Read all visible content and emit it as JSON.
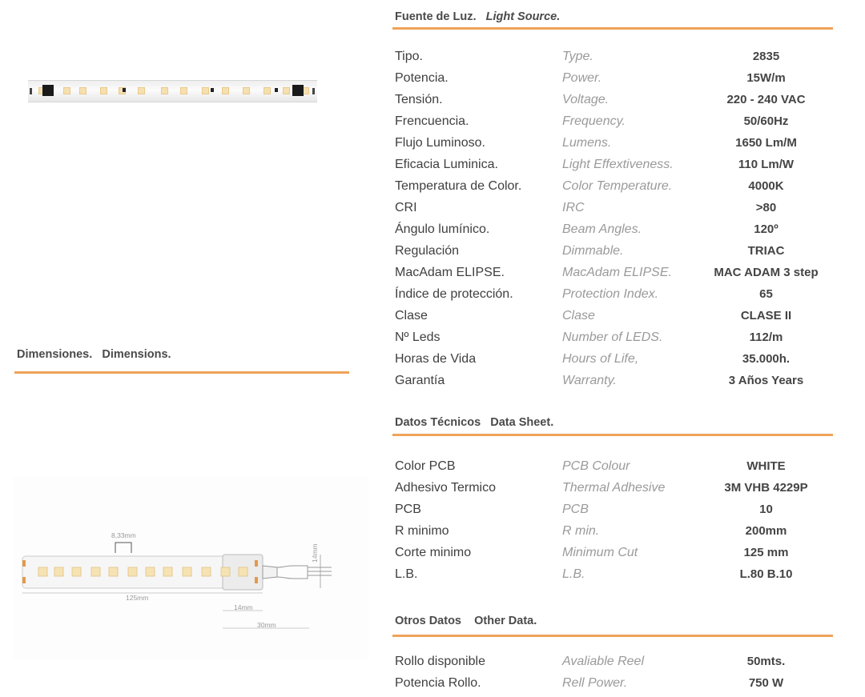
{
  "light_source": {
    "title_es": "Fuente de Luz.",
    "title_en": "Light Source.",
    "rows": [
      {
        "es": "Tipo.",
        "en": "Type.",
        "val": "2835"
      },
      {
        "es": "Potencia.",
        "en": "Power.",
        "val": "15W/m"
      },
      {
        "es": "Tensión.",
        "en": "Voltage.",
        "val": "220 - 240 VAC"
      },
      {
        "es": "Frencuencia.",
        "en": "Frequency.",
        "val": "50/60Hz"
      },
      {
        "es": "Flujo Luminoso.",
        "en": "Lumens.",
        "val": "1650 Lm/M"
      },
      {
        "es": "Eficacia Luminica.",
        "en": "Light Effextiveness.",
        "val": "110 Lm/W"
      },
      {
        "es": "Temperatura de Color.",
        "en": "Color Temperature.",
        "val": "4000K"
      },
      {
        "es": "CRI",
        "en": "IRC",
        "val": ">80"
      },
      {
        "es": "Ángulo lumínico.",
        "en": "Beam Angles.",
        "val": "120º"
      },
      {
        "es": "Regulación",
        "en": "Dimmable.",
        "val": "TRIAC"
      },
      {
        "es": "MacAdam ELIPSE.",
        "en": "MacAdam ELIPSE.",
        "val": "MAC ADAM 3 step"
      },
      {
        "es": "Índice de protección.",
        "en": "Protection Index.",
        "val": "65"
      },
      {
        "es": "Clase",
        "en": "Clase",
        "val": "CLASE II"
      },
      {
        "es": "Nº Leds",
        "en": "Number of LEDS.",
        "val": "112/m"
      },
      {
        "es": "Horas de Vida",
        "en": "Hours of Life,",
        "val": "35.000h."
      },
      {
        "es": "Garantía",
        "en": "Warranty.",
        "val": "3 Años   Years"
      }
    ]
  },
  "data_sheet": {
    "title": "Datos Técnicos   Data Sheet.",
    "rows": [
      {
        "es": "Color PCB",
        "en": "PCB Colour",
        "val": "WHITE"
      },
      {
        "es": "Adhesivo Termico",
        "en": "Thermal Adhesive",
        "val": "3M VHB 4229P"
      },
      {
        "es": "PCB",
        "en": "PCB",
        "val": "10"
      },
      {
        "es": "R minimo",
        "en": "R min.",
        "val": "200mm"
      },
      {
        "es": "Corte minimo",
        "en": "Minimum Cut",
        "val": "125 mm"
      },
      {
        "es": "L.B.",
        "en": "L.B.",
        "val": "L.80 B.10"
      }
    ]
  },
  "other_data": {
    "title": "Otros Datos    Other Data.",
    "rows": [
      {
        "es": "Rollo disponible",
        "en": "Avaliable Reel",
        "val": "50mts."
      },
      {
        "es": "Potencia Rollo.",
        "en": "Rell Power.",
        "val": "750 W"
      }
    ]
  },
  "dimensions": {
    "title": "Dimensiones.   Dimensions.",
    "labels": {
      "pitch": "8,33mm",
      "cut": "125mm",
      "end": "14mm",
      "tail": "30mm",
      "height": "14mm"
    }
  },
  "colors": {
    "accent": "#f0a25a"
  }
}
